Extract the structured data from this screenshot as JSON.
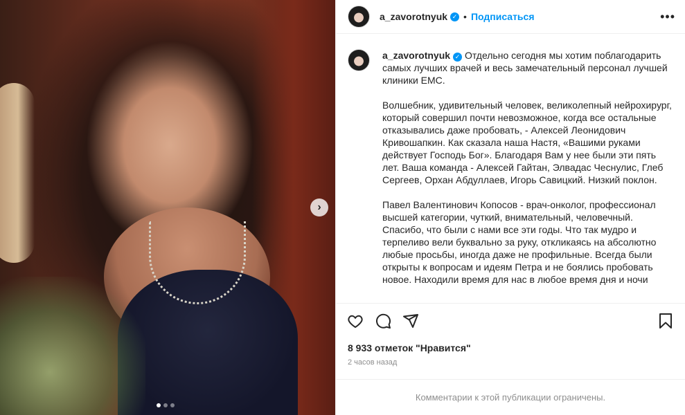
{
  "post": {
    "username": "a_zavorotnyuk",
    "follow_label": "Подписаться",
    "separator": "•",
    "more_icon": "more-horizontal-icon",
    "carousel": {
      "slides": 3,
      "active": 0
    },
    "caption": {
      "paragraphs": [
        "Отдельно сегодня мы хотим поблагодарить самых лучших врачей и весь замечательный персонал лучшей клиники EMC.",
        "Волшебник, удивительный человек, великолепный нейрохирург, который совершил почти невозможное, когда все остальные отказывались даже пробовать, - Алексей Леонидович Кривошапкин. Как сказала наша Настя, «Вашими руками действует Господь Бог». Благодаря Вам у нее были эти пять лет. Ваша команда - Алексей Гайтан, Элвадас Чеснулис, Глеб Сергеев, Орхан Абдуллаев, Игорь Савицкий. Низкий поклон.",
        "Павел Валентинович Копосов - врач-онколог, профессионал высшей категории, чуткий, внимательный, человечный. Спасибо, что были с нами все эти годы. Что так мудро и терпеливо вели буквально за руку, откликаясь на абсолютно любые просьбы, иногда даже не профильные. Всегда были открыты к вопросам и идеям Петра и не боялись пробовать новое. Находили время для нас в любое время дня и ночи"
      ]
    },
    "likes": "8 933 отметок \"Нравится\"",
    "time": "2 часов назад",
    "comments_limited": "Комментарии к этой публикации ограничены."
  },
  "colors": {
    "accent": "#0095f6",
    "text": "#262626",
    "muted": "#8e8e8e",
    "border": "#efefef"
  }
}
